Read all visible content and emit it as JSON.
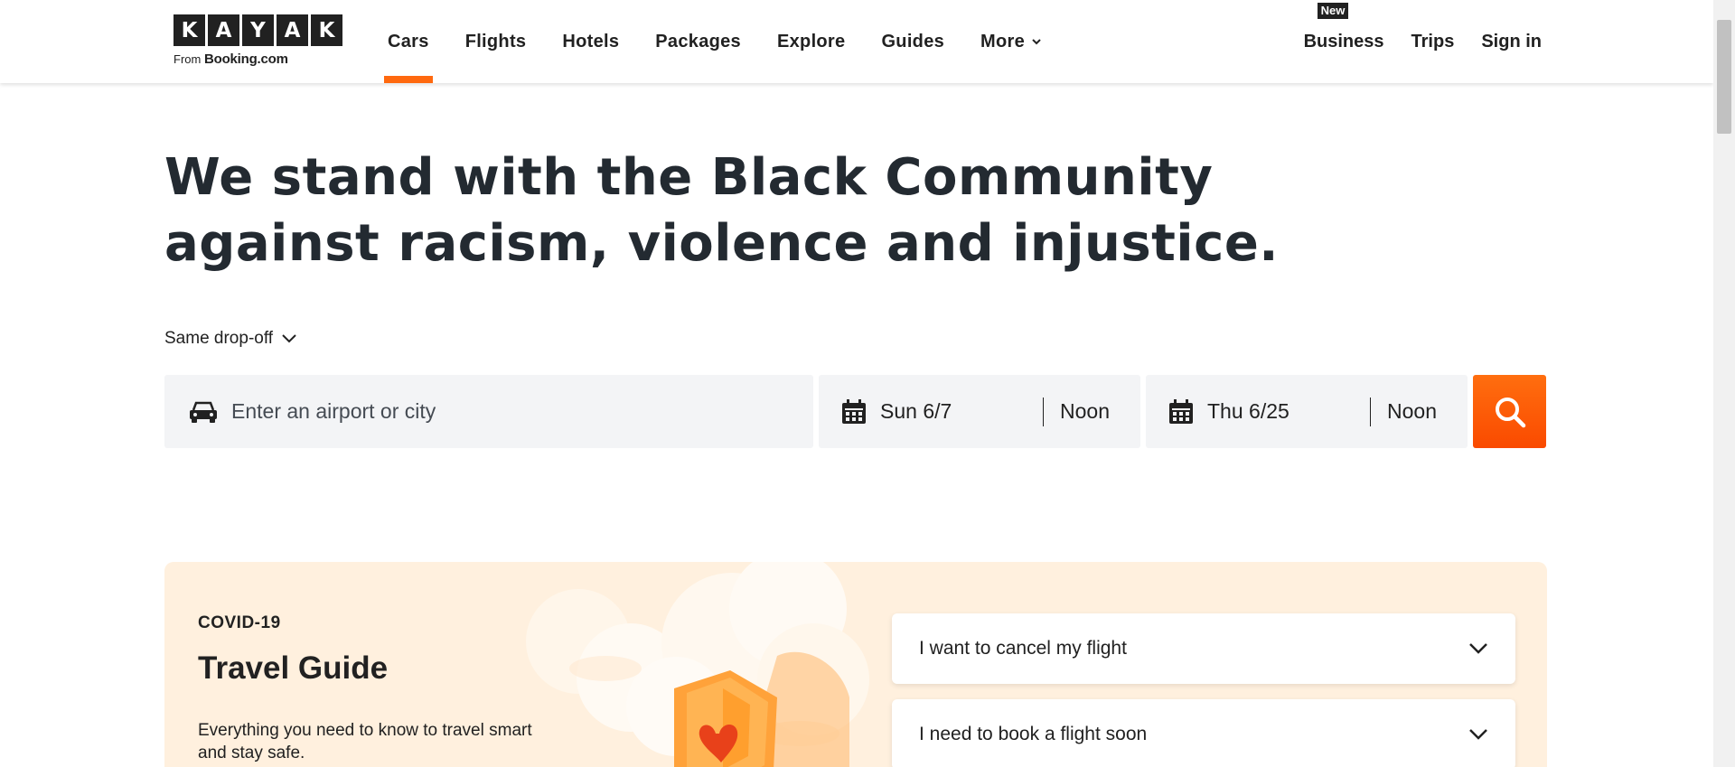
{
  "header": {
    "logo_letters": [
      "K",
      "A",
      "Y",
      "A",
      "K"
    ],
    "logo_from": "From",
    "logo_brand": "Booking.com",
    "nav": [
      {
        "label": "Cars",
        "active": true
      },
      {
        "label": "Flights",
        "active": false
      },
      {
        "label": "Hotels",
        "active": false
      },
      {
        "label": "Packages",
        "active": false
      },
      {
        "label": "Explore",
        "active": false
      },
      {
        "label": "Guides",
        "active": false
      },
      {
        "label": "More",
        "active": false,
        "icon": "chevron-down-icon"
      }
    ],
    "business_badge": "New",
    "business_label": "Business",
    "trips_label": "Trips",
    "signin_label": "Sign in",
    "accent_color": "#ff690f"
  },
  "headline": "We stand with the Black Community against racism, violence and injustice.",
  "search": {
    "dropoff_label": "Same drop-off",
    "location_placeholder": "Enter an airport or city",
    "location_icon": "car-icon",
    "pickup_date": "Sun 6/7",
    "pickup_time": "Noon",
    "dropoff_date": "Thu 6/25",
    "dropoff_time": "Noon",
    "date_icon": "calendar-icon",
    "search_icon": "search-icon",
    "button_color": "#ff5a00"
  },
  "covid": {
    "eyebrow": "COVID-19",
    "title": "Travel Guide",
    "description": "Everything you need to know to travel smart and stay safe.",
    "faqs": [
      {
        "label": "I want to cancel my flight",
        "icon": "chevron-down-icon"
      },
      {
        "label": "I need to book a flight soon",
        "icon": "chevron-down-icon"
      }
    ],
    "card_color": "#fff0de"
  }
}
